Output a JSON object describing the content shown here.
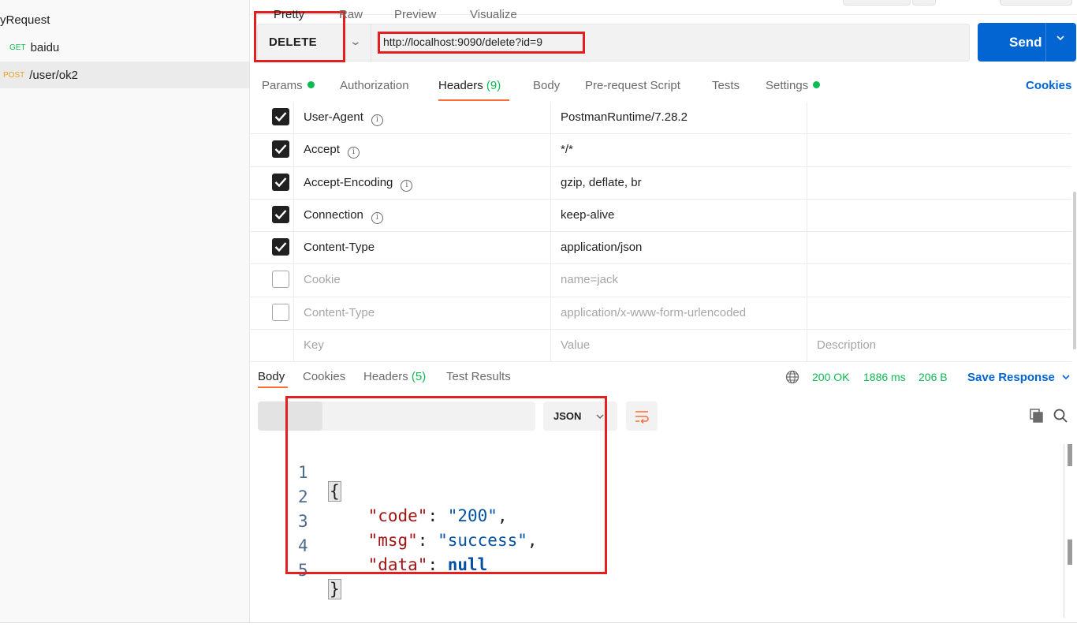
{
  "sidebar": {
    "title": "yRequest",
    "items": [
      {
        "method": "GET",
        "name": "baidu"
      },
      {
        "method": "POST",
        "name": "/user/ok2"
      }
    ]
  },
  "request": {
    "method": "DELETE",
    "url": "http://localhost:9090/delete?id=9",
    "send_label": "Send"
  },
  "tabs": {
    "params": "Params",
    "authorization": "Authorization",
    "headers": "Headers",
    "headers_count": "(9)",
    "body": "Body",
    "prerequest": "Pre-request Script",
    "tests": "Tests",
    "settings": "Settings",
    "cookies": "Cookies"
  },
  "headers_table": {
    "rows": [
      {
        "checked": true,
        "key": "User-Agent",
        "value": "PostmanRuntime/7.28.2",
        "info": true
      },
      {
        "checked": true,
        "key": "Accept",
        "value": "*/*",
        "info": true
      },
      {
        "checked": true,
        "key": "Accept-Encoding",
        "value": "gzip, deflate, br",
        "info": true
      },
      {
        "checked": true,
        "key": "Connection",
        "value": "keep-alive",
        "info": true
      },
      {
        "checked": true,
        "key": "Content-Type",
        "value": "application/json",
        "info": false
      },
      {
        "checked": false,
        "key": "Cookie",
        "value": "name=jack",
        "info": false
      },
      {
        "checked": false,
        "key": "Content-Type",
        "value": "application/x-www-form-urlencoded",
        "info": false
      }
    ],
    "placeholder": {
      "key": "Key",
      "value": "Value",
      "description": "Description"
    }
  },
  "response": {
    "tabs": {
      "body": "Body",
      "cookies": "Cookies",
      "headers": "Headers",
      "headers_count": "(5)",
      "test_results": "Test Results"
    },
    "status": "200 OK",
    "time": "1886 ms",
    "size": "206 B",
    "save_label": "Save Response",
    "formats": [
      "Pretty",
      "Raw",
      "Preview",
      "Visualize"
    ],
    "language": "JSON",
    "body_lines": [
      {
        "n": "1",
        "text": "{"
      },
      {
        "n": "2",
        "key": "\"code\"",
        "val": "\"200\"",
        "trail": ","
      },
      {
        "n": "3",
        "key": "\"msg\"",
        "val": "\"success\"",
        "trail": ","
      },
      {
        "n": "4",
        "key": "\"data\"",
        "val": "null",
        "trail": ""
      },
      {
        "n": "5",
        "text": "}"
      }
    ]
  },
  "colors": {
    "accent_blue": "#0265d2",
    "success_green": "#0cbb52",
    "tab_underline": "#ff6c37",
    "annotation_red": "#e32020"
  }
}
